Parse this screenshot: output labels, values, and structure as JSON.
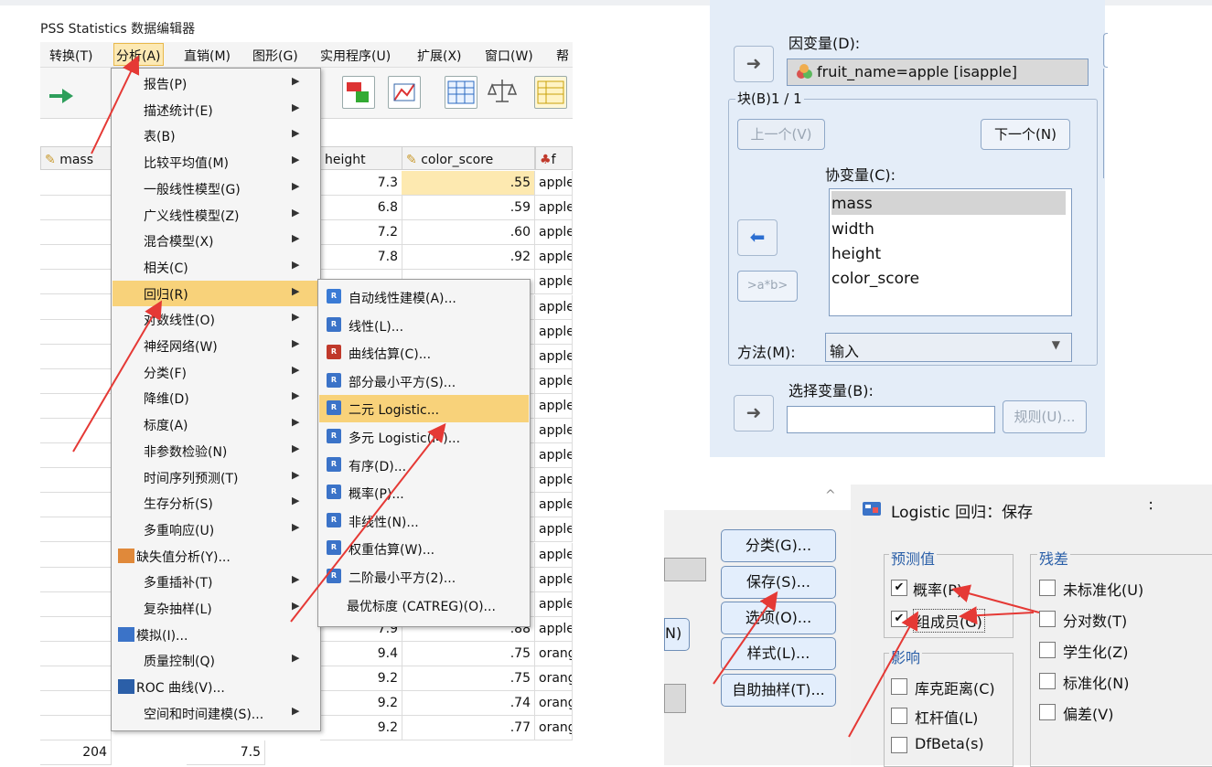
{
  "app": {
    "title": "PSS Statistics 数据编辑器"
  },
  "menubar": [
    {
      "label": "转换(T)"
    },
    {
      "label": "分析(A)"
    },
    {
      "label": "直销(M)"
    },
    {
      "label": "图形(G)"
    },
    {
      "label": "实用程序(U)"
    },
    {
      "label": "扩展(X)"
    },
    {
      "label": "窗口(W)"
    },
    {
      "label": "帮"
    }
  ],
  "grid": {
    "headers": [
      "mass",
      "height",
      "color_score",
      "f"
    ],
    "rows": [
      {
        "height": "7.3",
        "color": ".55",
        "fruit": "apple"
      },
      {
        "height": "6.8",
        "color": ".59",
        "fruit": "apple"
      },
      {
        "height": "7.2",
        "color": ".60",
        "fruit": "apple"
      },
      {
        "height": "7.8",
        "color": ".92",
        "fruit": "apple"
      },
      {
        "height": "",
        "color": "",
        "fruit": "apple"
      },
      {
        "height": "",
        "color": "",
        "fruit": "apple"
      },
      {
        "height": "",
        "color": "",
        "fruit": "apple"
      },
      {
        "height": "",
        "color": "",
        "fruit": "apple"
      },
      {
        "height": "",
        "color": "",
        "fruit": "apple"
      },
      {
        "height": "",
        "color": "",
        "fruit": "apple"
      },
      {
        "height": "",
        "color": "",
        "fruit": "apple"
      },
      {
        "height": "",
        "color": "",
        "fruit": "apple"
      },
      {
        "height": "",
        "color": "",
        "fruit": "apple"
      },
      {
        "height": "",
        "color": "",
        "fruit": "apple"
      },
      {
        "height": "",
        "color": "",
        "fruit": "apple"
      },
      {
        "height": "",
        "color": "",
        "fruit": "apple"
      },
      {
        "height": "",
        "color": "",
        "fruit": "apple"
      },
      {
        "height": "",
        "color": "",
        "fruit": "apple"
      },
      {
        "height": "7.9",
        "color": ".88",
        "fruit": "apple"
      },
      {
        "height": "9.4",
        "color": ".75",
        "fruit": "orang"
      },
      {
        "height": "9.2",
        "color": ".75",
        "fruit": "orang"
      },
      {
        "height": "9.2",
        "color": ".74",
        "fruit": "orang"
      },
      {
        "height": "9.2",
        "color": ".77",
        "fruit": "orang"
      }
    ],
    "partial_bottom": {
      "mass": "204",
      "width": "7.5"
    }
  },
  "analyze_menu": [
    {
      "label": "报告(P)",
      "sub": true
    },
    {
      "label": "描述统计(E)",
      "sub": true
    },
    {
      "label": "表(B)",
      "sub": true
    },
    {
      "label": "比较平均值(M)",
      "sub": true
    },
    {
      "label": "一般线性模型(G)",
      "sub": true
    },
    {
      "label": "广义线性模型(Z)",
      "sub": true
    },
    {
      "label": "混合模型(X)",
      "sub": true
    },
    {
      "label": "相关(C)",
      "sub": true
    },
    {
      "label": "回归(R)",
      "sub": true
    },
    {
      "label": "对数线性(O)",
      "sub": true
    },
    {
      "label": "神经网络(W)",
      "sub": true
    },
    {
      "label": "分类(F)",
      "sub": true
    },
    {
      "label": "降维(D)",
      "sub": true
    },
    {
      "label": "标度(A)",
      "sub": true
    },
    {
      "label": "非参数检验(N)",
      "sub": true
    },
    {
      "label": "时间序列预测(T)",
      "sub": true
    },
    {
      "label": "生存分析(S)",
      "sub": true
    },
    {
      "label": "多重响应(U)",
      "sub": true
    },
    {
      "label": "缺失值分析(Y)...",
      "sub": false
    },
    {
      "label": "多重插补(T)",
      "sub": true
    },
    {
      "label": "复杂抽样(L)",
      "sub": true
    },
    {
      "label": "模拟(I)...",
      "sub": false
    },
    {
      "label": "质量控制(Q)",
      "sub": true
    },
    {
      "label": "ROC 曲线(V)...",
      "sub": false
    },
    {
      "label": "空间和时间建模(S)...",
      "sub": true
    }
  ],
  "regression_submenu": [
    {
      "label": "自动线性建模(A)...",
      "icon": "auto-linear-icon",
      "color": "#3a7bd5"
    },
    {
      "label": "线性(L)...",
      "icon": "linear-icon",
      "color": "#3b73c8"
    },
    {
      "label": "曲线估算(C)...",
      "icon": "curve-icon",
      "color": "#c0392b"
    },
    {
      "label": "部分最小平方(S)...",
      "icon": "pls-icon",
      "color": "#3b73c8"
    },
    {
      "label": "二元 Logistic...",
      "icon": "logistic-icon",
      "color": "#3b73c8"
    },
    {
      "label": "多元 Logistic(M)...",
      "icon": "multinomial-icon",
      "color": "#3b73c8"
    },
    {
      "label": "有序(D)...",
      "icon": "ordinal-icon",
      "color": "#3b73c8"
    },
    {
      "label": "概率(P)...",
      "icon": "probit-icon",
      "color": "#3b73c8"
    },
    {
      "label": "非线性(N)...",
      "icon": "nonlinear-icon",
      "color": "#3b73c8"
    },
    {
      "label": "权重估算(W)...",
      "icon": "weight-icon",
      "color": "#3b73c8"
    },
    {
      "label": "二阶最小平方(2)...",
      "icon": "2sls-icon",
      "color": "#3b73c8"
    },
    {
      "label": "最优标度 (CATREG)(O)...",
      "icon": "",
      "color": ""
    }
  ],
  "logistic_dialog": {
    "dependent_label": "因变量(D):",
    "dependent_value": "fruit_name=apple [isapple]",
    "block_label": "块(B)1 / 1",
    "prev_button": "上一个(V)",
    "next_button": "下一个(N)",
    "covariates_label": "协变量(C):",
    "covariates": [
      "mass",
      "width",
      "height",
      "color_score"
    ],
    "interaction_button": ">a*b>",
    "method_label": "方法(M):",
    "method_value": "输入",
    "selection_label": "选择变量(B):",
    "rule_button": "规则(U)..."
  },
  "side_buttons": [
    "分类(G)...",
    "保存(S)...",
    "选项(O)...",
    "样式(L)...",
    "自助抽样(T)..."
  ],
  "partial_left_button": "N)",
  "save_dialog": {
    "title": "Logistic 回归：保存",
    "close_glyph": "∶",
    "predicted_group": "预测值",
    "predicted": [
      {
        "label": "概率(P)",
        "checked": true
      },
      {
        "label": "组成员(G)",
        "checked": true
      }
    ],
    "influence_group": "影响",
    "influence": [
      {
        "label": "库克距离(C)",
        "checked": false
      },
      {
        "label": "杠杆值(L)",
        "checked": false
      },
      {
        "label": "DfBeta(s)",
        "checked": false
      }
    ],
    "residuals_group": "残差",
    "residuals": [
      {
        "label": "未标准化(U)",
        "checked": false
      },
      {
        "label": "分对数(T)",
        "checked": false
      },
      {
        "label": "学生化(Z)",
        "checked": false
      },
      {
        "label": "标准化(N)",
        "checked": false
      },
      {
        "label": "偏差(V)",
        "checked": false
      }
    ]
  },
  "colors": {
    "highlight": "#f8d27a",
    "arrow": "#e53935",
    "dialog_blue": "#e4edf8",
    "group_label": "#2a5fa8"
  }
}
